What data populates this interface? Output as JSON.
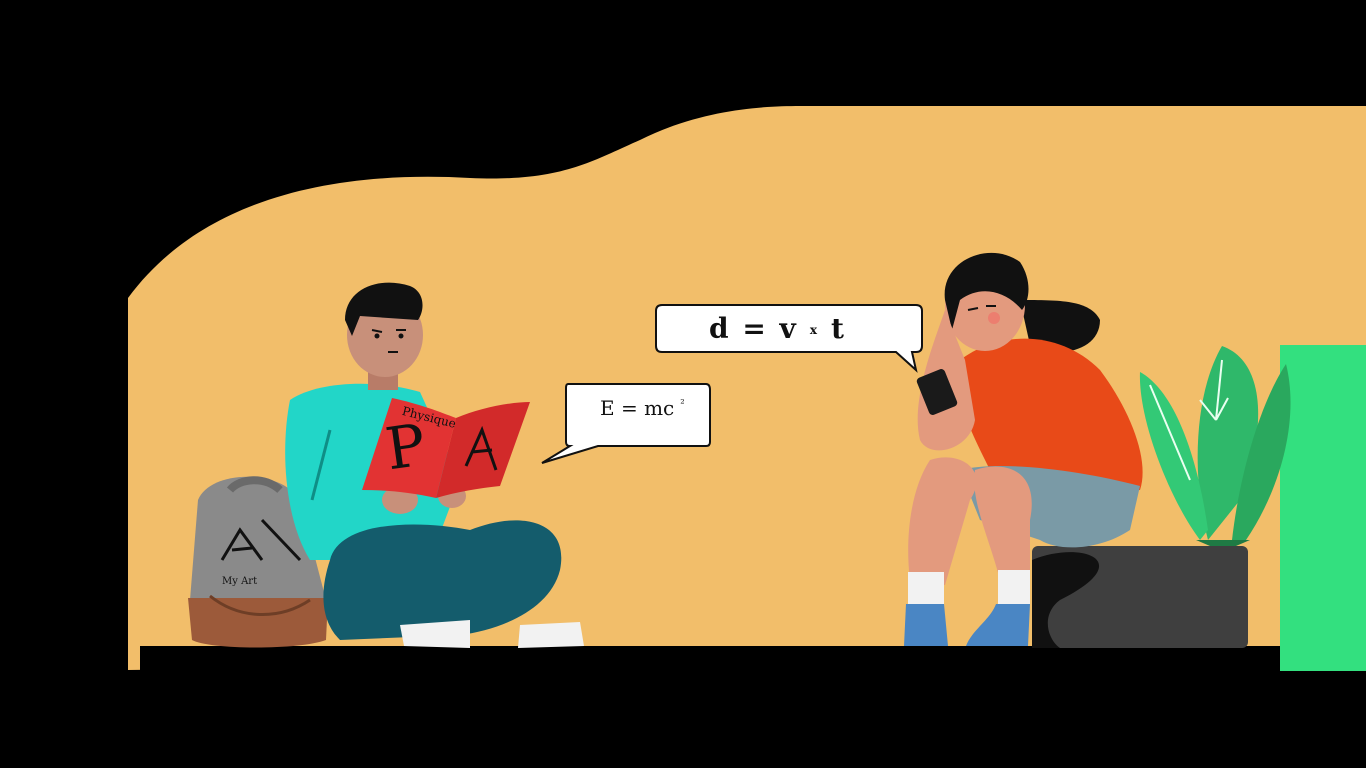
{
  "scene": {
    "boy_bubble": {
      "formula_base": "E = mc",
      "formula_exponent": "²"
    },
    "girl_bubble": {
      "d": "d",
      "eq": "=",
      "v": "v",
      "times": "x",
      "t": "t"
    },
    "book": {
      "title": "Physique",
      "letter": "P"
    },
    "backpack": {
      "brand": "My Art"
    }
  },
  "colors": {
    "background": "#000000",
    "wall": "#f2be6a",
    "floor": "#000000",
    "boy_shirt": "#22d6c8",
    "boy_pants": "#145c6c",
    "boy_skin": "#c8907a",
    "book_cover": "#e23333",
    "backpack_top": "#8a8a8a",
    "backpack_bottom": "#9c5a3a",
    "girl_shirt": "#e84a18",
    "girl_skin": "#e39a7e",
    "girl_shorts": "#7a9aa6",
    "girl_shoes": "#4a86c4",
    "bench": "#3f3f3f",
    "plant_leaf": "#2fb86a",
    "plant_panel": "#33e07f"
  }
}
